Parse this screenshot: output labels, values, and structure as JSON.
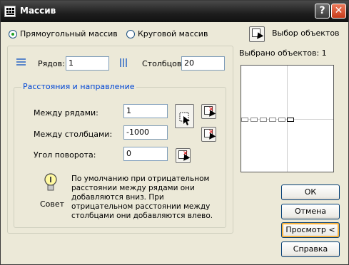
{
  "window": {
    "title": "Массив",
    "help_label": "?",
    "close_label": "✕"
  },
  "mode": {
    "rect_label": "Прямоугольный массив",
    "polar_label": "Круговой массив",
    "selected": "rect"
  },
  "select_objects": {
    "label": "Выбор объектов",
    "count_label": "Выбрано объектов: 1"
  },
  "rows": {
    "label": "Рядов:",
    "value": "1"
  },
  "columns": {
    "label": "Столбцов:",
    "value": "20"
  },
  "spacing_group": {
    "title": "Расстояния и направление",
    "row_offset": {
      "label": "Между рядами:",
      "value": "1"
    },
    "col_offset": {
      "label": "Между столбцами:",
      "value": "-1000"
    },
    "angle": {
      "label": "Угол поворота:",
      "value": "0"
    }
  },
  "tip": {
    "label": "Совет",
    "text": "По умолчанию при отрицательном расстоянии между рядами они добавляются вниз. При отрицательном расстоянии между столбцами они добавляются влево."
  },
  "buttons": {
    "ok": "ОК",
    "cancel": "Отмена",
    "preview": "Просмотр <",
    "help": "Справка"
  },
  "colors": {
    "accent_blue": "#0046d5",
    "title_bar": "#1e1e1e",
    "dialog_bg": "#ece9d8"
  }
}
